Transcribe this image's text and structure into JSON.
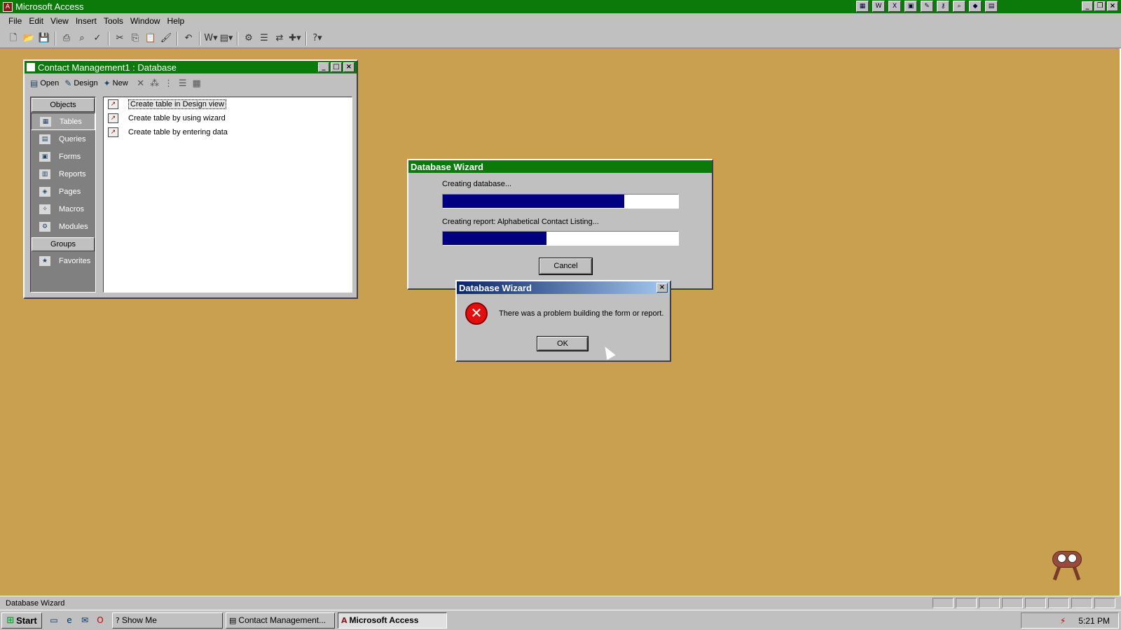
{
  "app": {
    "title": "Microsoft Access",
    "tray_icons": [
      "calendar-icon",
      "word-icon",
      "excel-icon",
      "photo-icon",
      "tools-icon",
      "key-icon",
      "find-icon",
      "office-icon",
      "calc-icon"
    ]
  },
  "menu": [
    "File",
    "Edit",
    "View",
    "Insert",
    "Tools",
    "Window",
    "Help"
  ],
  "toolbar": {
    "icons": [
      "new-icon",
      "open-icon",
      "save-icon",
      "print-icon",
      "preview-icon",
      "spell-icon",
      "cut-icon",
      "copy-icon",
      "paste-icon",
      "format-painter-icon",
      "undo-icon",
      "office-links-icon",
      "analyze-icon",
      "code-icon",
      "properties-icon",
      "relationships-icon",
      "new-object-icon",
      "help-icon"
    ]
  },
  "db_window": {
    "title": "Contact Management1 : Database",
    "tools": {
      "open": "Open",
      "design": "Design",
      "new": "New"
    },
    "objects_label": "Objects",
    "objects": [
      {
        "label": "Tables",
        "icon": "table-icon"
      },
      {
        "label": "Queries",
        "icon": "query-icon"
      },
      {
        "label": "Forms",
        "icon": "form-icon"
      },
      {
        "label": "Reports",
        "icon": "report-icon"
      },
      {
        "label": "Pages",
        "icon": "page-icon"
      },
      {
        "label": "Macros",
        "icon": "macro-icon"
      },
      {
        "label": "Modules",
        "icon": "module-icon"
      }
    ],
    "selected_object": "Tables",
    "groups_label": "Groups",
    "favorites": "Favorites",
    "items": [
      "Create table in Design view",
      "Create table by using wizard",
      "Create table by entering data"
    ]
  },
  "wizard": {
    "title": "Database Wizard",
    "line1": "Creating database...",
    "progress1": 0.77,
    "line2": "Creating report: Alphabetical Contact Listing...",
    "progress2": 0.44,
    "cancel": "Cancel"
  },
  "error_dialog": {
    "title": "Database Wizard",
    "message": "There was a problem building the form or report.",
    "ok": "OK"
  },
  "status": {
    "text": "Database Wizard"
  },
  "taskbar": {
    "start": "Start",
    "tasks": [
      {
        "label": "Show Me",
        "active": false
      },
      {
        "label": "Contact Management...",
        "active": false
      },
      {
        "label": "Microsoft Access",
        "active": true
      }
    ],
    "time": "5:21 PM"
  },
  "colors": {
    "desktop": "#c8a050",
    "title_green": "#0b7a0b",
    "progress": "#000080",
    "error": "#e01010"
  }
}
